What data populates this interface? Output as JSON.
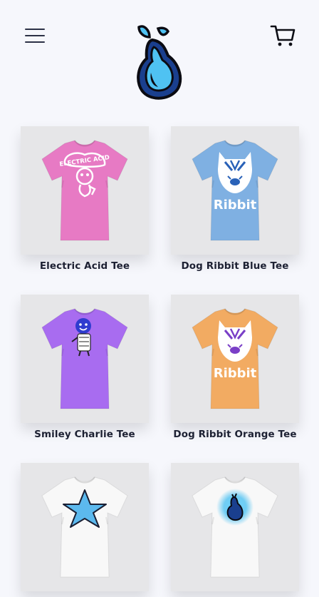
{
  "header": {
    "menu_icon": "hamburger-menu-icon",
    "logo_icon": "pear-logo-icon",
    "cart_icon": "shopping-cart-icon"
  },
  "products": [
    {
      "name": "Electric Acid Tee",
      "shirt_color": "#e77ac4",
      "graphic": "electric-acid",
      "graphic_text": "ELECTRIC ACID"
    },
    {
      "name": "Dog Ribbit Blue Tee",
      "shirt_color": "#7fb0e2",
      "graphic": "dog-ribbit",
      "graphic_text": "Ribbit"
    },
    {
      "name": "Smiley Charlie Tee",
      "shirt_color": "#a86cf0",
      "graphic": "smiley-charlie"
    },
    {
      "name": "Dog Ribbit Orange Tee",
      "shirt_color": "#f2ab62",
      "graphic": "dog-ribbit",
      "graphic_text": "Ribbit"
    },
    {
      "name": "",
      "shirt_color": "#f8f8f8",
      "graphic": "blue-star"
    },
    {
      "name": "",
      "shirt_color": "#f8f8f8",
      "graphic": "glow-pear"
    }
  ],
  "colors": {
    "background": "#f6f7fc",
    "text": "#1e2235",
    "image_bg": "#e6e6e8",
    "logo_blue": "#4fc2f2"
  }
}
